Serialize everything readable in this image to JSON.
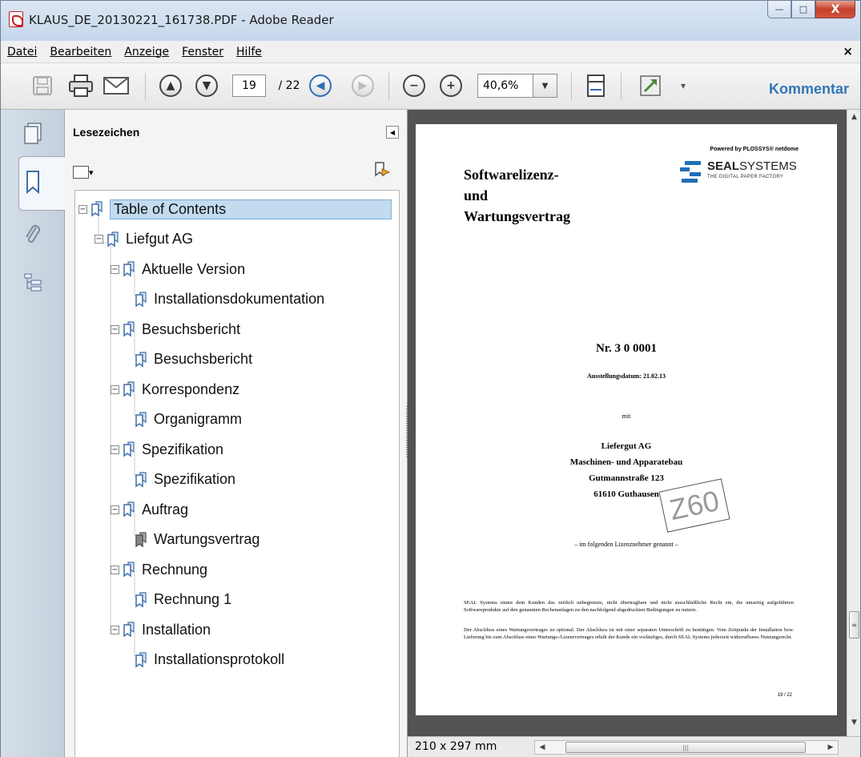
{
  "window": {
    "title": "KLAUS_DE_20130221_161738.PDF - Adobe Reader",
    "min_label": "—",
    "max_label": "□",
    "close_label": "X"
  },
  "menu": {
    "items": [
      "Datei",
      "Bearbeiten",
      "Anzeige",
      "Fenster",
      "Hilfe"
    ],
    "close_label": "×"
  },
  "toolbar": {
    "page_current": "19",
    "page_total": "/ 22",
    "zoom": "40,6%",
    "comment_label": "Kommentar"
  },
  "bookmarks": {
    "title": "Lesezeichen",
    "items": [
      {
        "label": "Table of Contents",
        "level": 0,
        "expander": "⊟",
        "selected": true
      },
      {
        "label": "Liefgut AG",
        "level": 1,
        "expander": "⊟"
      },
      {
        "label": "Aktuelle Version",
        "level": 2,
        "expander": "⊟"
      },
      {
        "label": "Installationsdokumentation",
        "level": 3,
        "expander": ""
      },
      {
        "label": "Besuchsbericht",
        "level": 2,
        "expander": "⊟"
      },
      {
        "label": "Besuchsbericht",
        "level": 3,
        "expander": ""
      },
      {
        "label": "Korrespondenz",
        "level": 2,
        "expander": "⊟"
      },
      {
        "label": "Organigramm",
        "level": 3,
        "expander": ""
      },
      {
        "label": "Spezifikation",
        "level": 2,
        "expander": "⊟"
      },
      {
        "label": "Spezifikation",
        "level": 3,
        "expander": ""
      },
      {
        "label": "Auftrag",
        "level": 2,
        "expander": "⊟"
      },
      {
        "label": "Wartungsvertrag",
        "level": 3,
        "expander": "",
        "gray": true
      },
      {
        "label": "Rechnung",
        "level": 2,
        "expander": "⊟"
      },
      {
        "label": "Rechnung 1",
        "level": 3,
        "expander": ""
      },
      {
        "label": "Installation",
        "level": 2,
        "expander": "⊟"
      },
      {
        "label": "Installationsprotokoll",
        "level": 3,
        "expander": ""
      }
    ]
  },
  "document": {
    "title_lines": [
      "Softwarelizenz-",
      "und",
      "Wartungsvertrag"
    ],
    "powered": "Powered by PLOSSYS® netdome",
    "logo_bold": "SEAL",
    "logo_rest": "SYSTEMS",
    "logo_tagline": "THE DIGITAL PAPER FACTORY",
    "number": "Nr.  3 0 0001",
    "ausstellung": "Ausstellungsdatum:  21.02.13",
    "mit": "mit",
    "address": [
      "Liefergut AG",
      "Maschinen- und Apparatebau",
      "Gutmannstraße 123",
      "61610 Guthausen"
    ],
    "stamp": "Z60",
    "folgend": "– im folgenden Lizenznehmer genannt –",
    "para1": "SEAL Systems räumt dem Kunden das zeitlich unbegrenzte, nicht übertragbare und nicht ausschließliche Recht ein, die umseitig aufgeführten Softwareprodukte auf den genannten Rechenanlagen zu den nachfolgend abgedruckten Bedingungen zu nutzen.",
    "para2": "Der Abschluss eines Wartungsvertrages ist optional. Der Abschluss ist mit einer separaten Unterschrift zu bestätigen. Vom Zeitpunkt der Installation bzw. Lieferung bis zum Abschluss eines Wartungs-/Lizenzvertrages erhält der Kunde ein vorläufiges, durch SEAL Systems jederzeit widerrufbares Nutzungsrecht.",
    "page_number": "19 / 22"
  },
  "status": {
    "page_size": "210 x 297 mm"
  }
}
